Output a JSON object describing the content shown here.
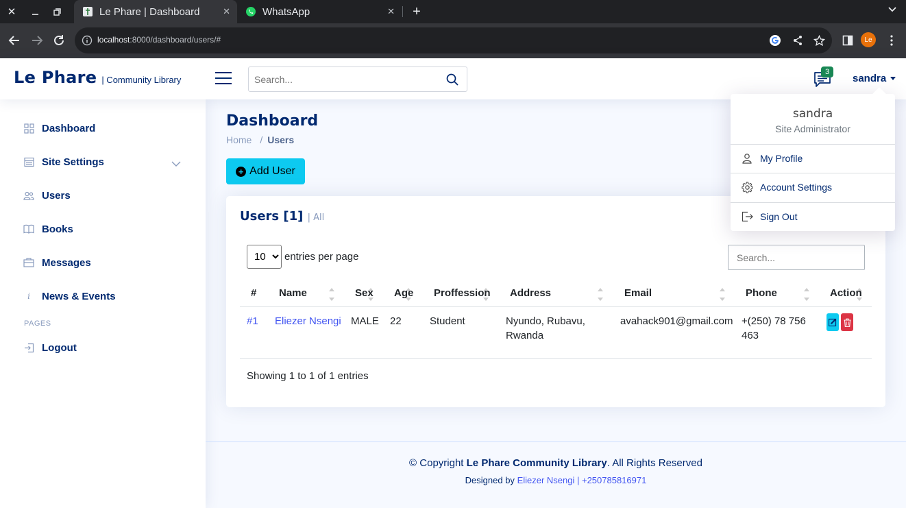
{
  "browser": {
    "tabs": [
      {
        "title": "Le Phare | Dashboard",
        "active": true
      },
      {
        "title": "WhatsApp",
        "active": false
      }
    ],
    "url_host": "localhost",
    "url_rest": ":8000/dashboard/users/#",
    "profile_initials": "Le",
    "profile_color": "#e8710a"
  },
  "header": {
    "brand": "Le Phare",
    "subtitle": "| Community Library",
    "search_placeholder": "Search...",
    "message_count": "3",
    "username": "sandra"
  },
  "sidebar": {
    "items": [
      {
        "label": "Dashboard",
        "icon": "grid-icon"
      },
      {
        "label": "Site Settings",
        "icon": "menu-icon"
      },
      {
        "label": "Users",
        "icon": "people-icon"
      },
      {
        "label": "Books",
        "icon": "book-icon"
      },
      {
        "label": "Messages",
        "icon": "envelope-icon"
      },
      {
        "label": "News & Events",
        "icon": "info-icon"
      }
    ],
    "heading": "PAGES",
    "logout": "Logout"
  },
  "main": {
    "title": "Dashboard",
    "breadcrumb": [
      "Home",
      "Users"
    ],
    "add_button": "Add User",
    "card_title": "Users [1]",
    "card_title_link": "| All",
    "per_page_value": "10",
    "per_page_label": "entries per page",
    "table_search_placeholder": "Search...",
    "columns": [
      "#",
      "Name",
      "Sex",
      "Age",
      "Proffession",
      "Address",
      "Email",
      "Phone",
      "Action"
    ],
    "rows": [
      {
        "id": "#1",
        "name": "Eliezer Nsengi",
        "sex": "MALE",
        "age": "22",
        "profession": "Student",
        "address_line1": "Nyundo, Rubavu,",
        "address_line2": "Rwanda",
        "email": "avahack901@gmail.com",
        "phone_line1": "+(250) 78 756",
        "phone_line2": "463"
      }
    ],
    "showing": "Showing 1 to 1 of 1 entries"
  },
  "footer": {
    "copyright_prefix": "© Copyright",
    "copyright_name": "Le Phare Community Library",
    "copyright_suffix": ". All Rights Reserved",
    "designed_prefix": "Designed by",
    "designed_by": "Eliezer Nsengi | +250785816971"
  },
  "dropdown": {
    "name": "sandra",
    "role": "Site Administrator",
    "items": [
      "My Profile",
      "Account Settings",
      "Sign Out"
    ]
  },
  "colors": {
    "primary": "#012970",
    "link": "#4154f1",
    "info": "#0dcaf0",
    "danger": "#dc3545",
    "badge": "#198754"
  }
}
